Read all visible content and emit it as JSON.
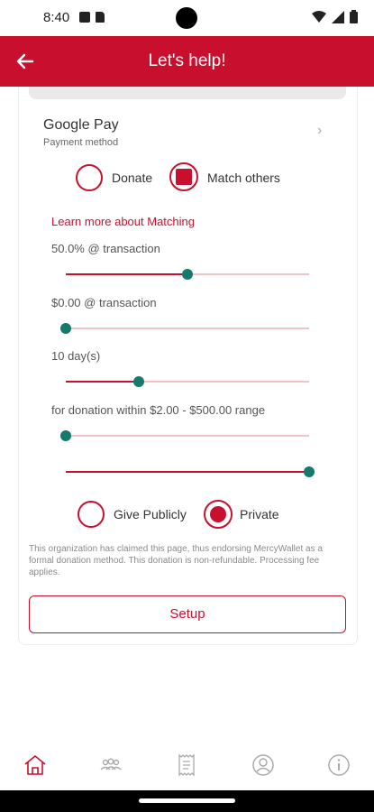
{
  "status": {
    "time": "8:40"
  },
  "appbar": {
    "title": "Let's help!"
  },
  "payment": {
    "method_name": "Google Pay",
    "method_sub": "Payment method",
    "chevron": "›"
  },
  "mode_options": [
    {
      "label": "Donate",
      "selected": false
    },
    {
      "label": "Match others",
      "selected": true
    }
  ],
  "learn_more_link": "Learn more about Matching",
  "sliders": {
    "percent": {
      "label": "50.0% @ transaction",
      "fraction": 0.5
    },
    "amount": {
      "label": "$0.00 @ transaction",
      "fraction": 0.0
    },
    "days": {
      "label": "10 day(s)",
      "fraction": 0.3
    },
    "range": {
      "label": "for donation within $2.00 - $500.00 range",
      "min_fraction": 0.0,
      "max_fraction": 1.0
    }
  },
  "visibility_options": [
    {
      "label": "Give Publicly",
      "selected": false
    },
    {
      "label": "Private",
      "selected": true
    }
  ],
  "disclaimer": "This organization has claimed this page, thus endorsing MercyWallet as a formal donation method. This donation is non-refundable. Processing fee applies.",
  "setup_button": "Setup",
  "colors": {
    "brand": "#c8102e",
    "thumb": "#137a6c",
    "track": "#f0c3c9"
  },
  "bottom_nav": [
    "home-icon",
    "community-icon",
    "receipt-icon",
    "profile-icon",
    "info-icon"
  ]
}
